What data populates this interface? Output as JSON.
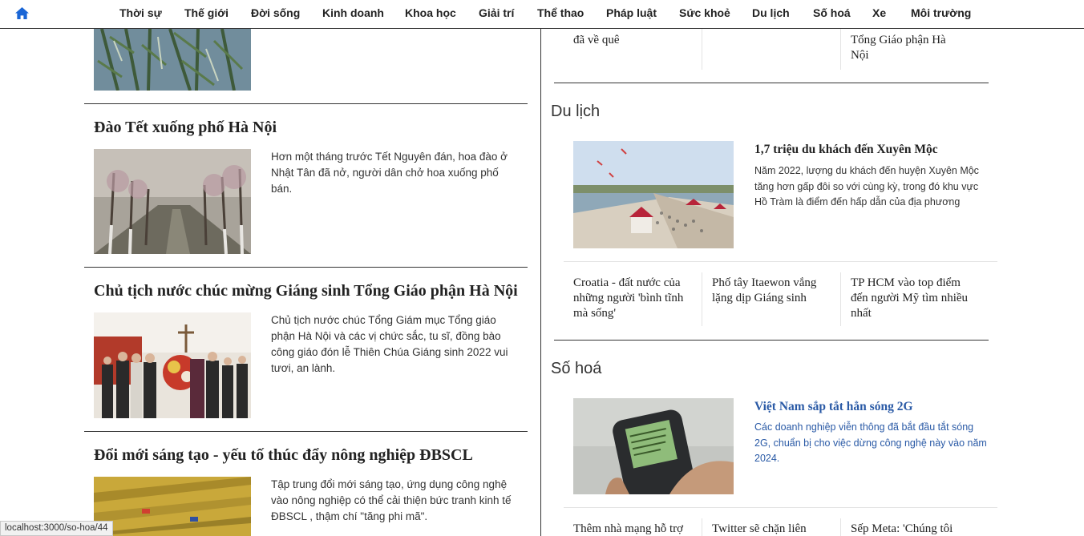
{
  "nav": {
    "items": [
      "Thời sự",
      "Thế giới",
      "Đời sống",
      "Kinh doanh",
      "Khoa học",
      "Giải trí",
      "Thể thao",
      "Pháp luật",
      "Sức khoẻ",
      "Du lịch",
      "Số hoá",
      "Xe",
      "Môi trường"
    ]
  },
  "left": {
    "articles": [
      {
        "title": "Đào Tết xuống phố Hà Nội",
        "desc": "Hơn một tháng trước Tết Nguyên đán, hoa đào ở Nhật Tân đã nở, người dân chở hoa xuống phố bán."
      },
      {
        "title": "Chủ tịch nước chúc mừng Giáng sinh Tổng Giáo phận Hà Nội",
        "desc": "Chủ tịch nước chúc Tổng Giám mục Tổng giáo phận Hà Nội và các vị chức sắc, tu sĩ, đồng bào công giáo đón lễ Thiên Chúa Giáng sinh 2022 vui tươi, an lành."
      },
      {
        "title": "Đổi mới sáng tạo - yếu tố thúc đẩy nông nghiệp ĐBSCL",
        "desc": "Tập trung đổi mới sáng tạo, ứng dụng công nghệ vào nông nghiệp có thể cải thiện bức tranh kinh tế ĐBSCL , thậm chí \"tăng phi mã\"."
      }
    ]
  },
  "right": {
    "top_partial": [
      "đã về quê",
      "Tổng Giáo phận Hà Nội"
    ],
    "du_lich": {
      "title": "Du lịch",
      "feature_title": "1,7 triệu du khách đến Xuyên Mộc",
      "feature_desc": "Năm 2022, lượng du khách đến huyện Xuyên Mộc tăng hơn gấp đôi so với cùng kỳ, trong đó khu vực Hồ Tràm là điểm đến hấp dẫn của địa phương",
      "items": [
        "Croatia - đất nước của những người 'bình tĩnh mà sống'",
        "Phố tây Itaewon vắng lặng dịp Giáng sinh",
        "TP HCM vào top điểm đến người Mỹ tìm nhiều nhất"
      ]
    },
    "so_hoa": {
      "title": "Số hoá",
      "feature_title": "Việt Nam sắp tắt hẳn sóng 2G",
      "feature_desc": "Các doanh nghiệp viễn thông đã bắt đầu tắt sóng 2G, chuẩn bị cho việc dừng công nghệ này vào năm 2024.",
      "items": [
        "Thêm nhà mạng hỗ trợ",
        "Twitter sẽ chặn liên",
        "Sếp Meta: 'Chúng tôi"
      ]
    }
  },
  "status_url": "localhost:3000/so-hoa/44",
  "colors": {
    "link_hover": "#2a5aa6",
    "home_icon": "#1a66d6"
  }
}
